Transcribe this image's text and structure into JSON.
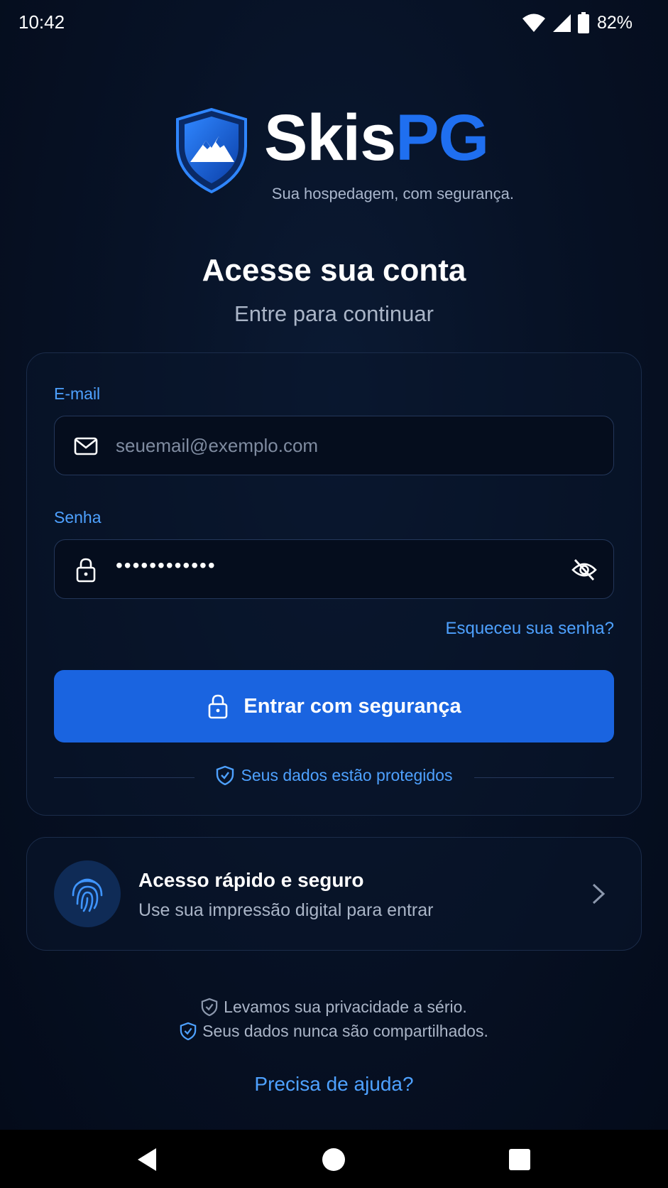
{
  "status_bar": {
    "time": "10:42",
    "battery_percent": "82%"
  },
  "brand": {
    "name_part1": "Skis",
    "name_part2": "PG",
    "tagline": "Sua hospedagem, com segurança."
  },
  "header": {
    "title": "Acesse sua conta",
    "subtitle": "Entre para continuar"
  },
  "login_form": {
    "email_label": "E-mail",
    "email_placeholder": "seuemail@exemplo.com",
    "password_label": "Senha",
    "password_mask": "••••••••••••",
    "forgot_link": "Esqueceu sua senha?",
    "submit_label": "Entrar com segurança",
    "protection_note": "Seus dados estão protegidos"
  },
  "biometric": {
    "title": "Acesso rápido e seguro",
    "subtitle": "Use sua impressão digital para entrar"
  },
  "privacy": {
    "line1": "Levamos sua privacidade a sério.",
    "line2": "Seus dados nunca são compartilhados."
  },
  "help_link": "Precisa de ajuda?",
  "colors": {
    "accent": "#1a64e0",
    "link": "#4ea1ff",
    "background": "#040b1a"
  },
  "icons": [
    "wifi-icon",
    "signal-icon",
    "battery-icon",
    "mail-icon",
    "lock-icon",
    "eye-off-icon",
    "shield-check-icon",
    "fingerprint-icon",
    "chevron-right-icon",
    "back-icon",
    "home-icon",
    "recents-icon"
  ]
}
